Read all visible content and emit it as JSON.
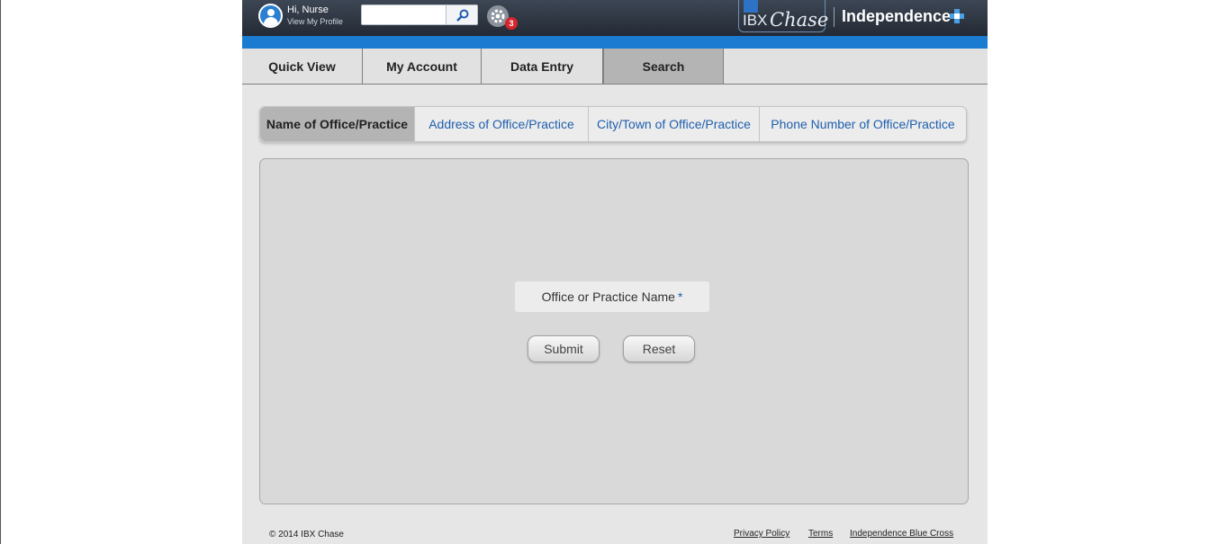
{
  "header": {
    "greeting": "Hi, Nurse",
    "profile_link": "View My Profile",
    "search": {
      "value": "",
      "placeholder": ""
    },
    "notifications_count": "3",
    "logo_ibx": "IBX",
    "logo_chase": "Chase",
    "logo_independence": "Independence",
    "accent_color": "#1b7bd0"
  },
  "main_nav": {
    "tabs": [
      {
        "label": "Quick View",
        "active": false
      },
      {
        "label": "My Account",
        "active": false
      },
      {
        "label": "Data Entry",
        "active": false
      },
      {
        "label": "Search",
        "active": true
      }
    ]
  },
  "sub_tabs": [
    {
      "label": "Name of Office/Practice",
      "active": true
    },
    {
      "label": "Address of Office/Practice",
      "active": false
    },
    {
      "label": "City/Town of Office/Practice",
      "active": false
    },
    {
      "label": "Phone Number of Office/Practice",
      "active": false
    }
  ],
  "form": {
    "field_label": "Office or Practice Name",
    "required_marker": "*",
    "submit_label": "Submit",
    "reset_label": "Reset"
  },
  "footer": {
    "copyright": "© 2014 IBX Chase",
    "links": [
      "Privacy Policy",
      "Terms",
      "Independence Blue Cross"
    ]
  }
}
